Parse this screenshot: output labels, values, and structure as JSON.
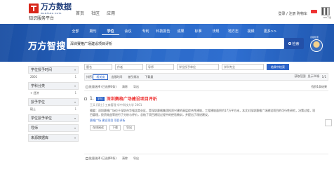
{
  "brand": {
    "name": "万方数据",
    "name_en": "WANFANG DATA",
    "subtitle": "知识服务平台"
  },
  "topnav": {
    "items": [
      "首页",
      "社区",
      "应用"
    ]
  },
  "account": {
    "text": "登录 / 注册  购物车",
    "qr_label": "APP下载"
  },
  "catnav": {
    "items": [
      "全部",
      "期刊",
      "学位",
      "会议",
      "专利",
      "科技报告",
      "成果",
      "标准",
      "法规",
      "地方志",
      "视频",
      "更多>>"
    ],
    "active_index": 2
  },
  "hero": {
    "title": "万方智搜",
    "adv_label": "高级检索"
  },
  "search": {
    "value": "深圳赛格广场建设项目评析",
    "button": "检索"
  },
  "sidebar": {
    "filters": [
      {
        "label": "学位授予时间",
        "items": [
          {
            "label": "2001",
            "count": "1"
          }
        ]
      },
      {
        "label": "学科分类",
        "items": [
          {
            "label": "+ 经济",
            "count": "1"
          }
        ]
      },
      {
        "label": "授予学位",
        "items": [
          {
            "label": "硕士",
            "count": "1"
          }
        ]
      },
      {
        "label": "学位授予单位",
        "items": []
      },
      {
        "label": "导师",
        "items": []
      },
      {
        "label": "来源数据库",
        "items": []
      }
    ]
  },
  "result_filters": {
    "fields": [
      "题名",
      "作者",
      "导师",
      "学位授予单位",
      "学科专业"
    ],
    "button": "结果中检索"
  },
  "sortbar": {
    "label": "排序:",
    "sorts": [
      "相关度",
      "出版时间",
      "被引频次",
      "下载量"
    ],
    "active": "相关度",
    "right": [
      "获取范围",
      "显示20条",
      "1/1"
    ]
  },
  "select_bar": {
    "select_all": "批量选择 (已选择0条)",
    "clear": "清除",
    "export": "导出",
    "count": "找到1条结果"
  },
  "result": {
    "num": "1.",
    "type": "学位",
    "title_pre": "",
    "title_hl": "深圳赛格广场建设项目评析",
    "meta": "王兵 [硕士]  工商管理  华中科技大学  2001",
    "abstract": "摘要：深圳赛格广场位于深圳市华强北商业区，是深圳赛格集团投资兴建的高层综合性建筑，工程建筑面积约17万平方米，本文对深圳赛格广场建设项目的可行性研究，决策过程，项目管理，投资效益等进行了分析与评价，总结了项目建设过程中的经验教训，并提出了改进建议。",
    "keywords": "赛格广场  建设项目  项目评析",
    "actions": [
      "在线阅读",
      "下载",
      "导出"
    ]
  },
  "bottom_select": {
    "select_all": "批量选择 (已选择0条)",
    "clear": "清除",
    "export": "导出"
  }
}
